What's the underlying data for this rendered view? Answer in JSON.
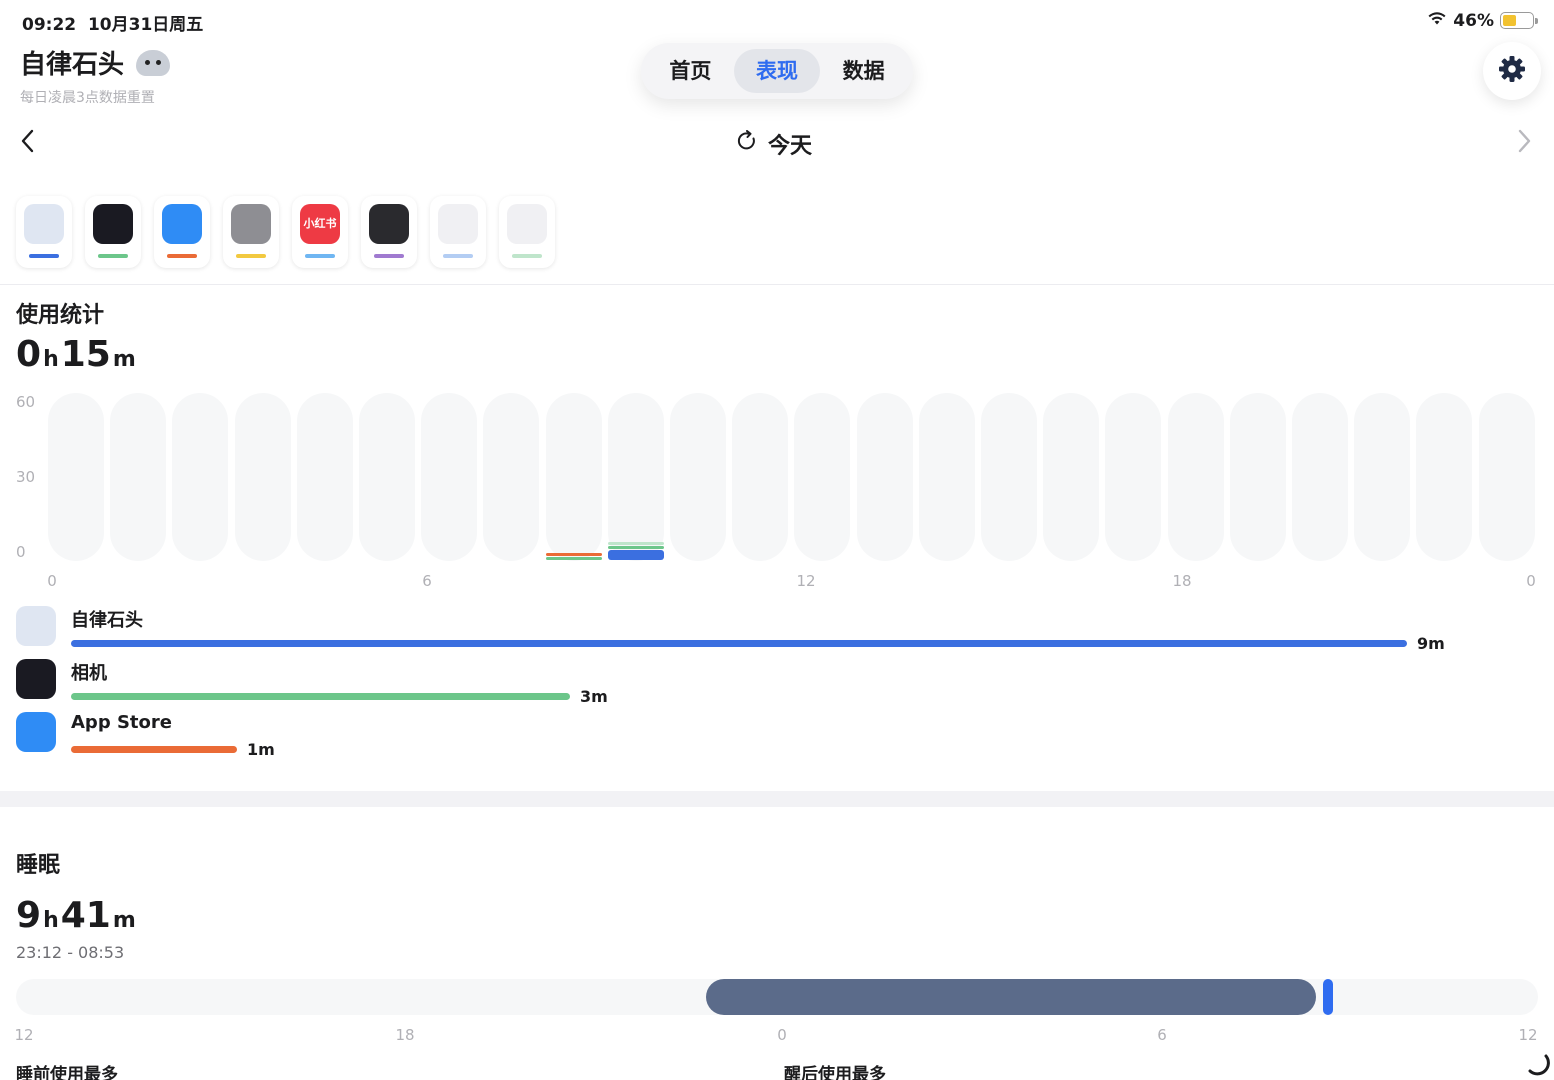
{
  "status": {
    "time": "09:22",
    "date": "10月31日周五",
    "battery": "46%",
    "battery_level": 0.46
  },
  "header": {
    "title": "自律石头",
    "subtitle": "每日凌晨3点数据重置"
  },
  "tabs": [
    {
      "label": "首页",
      "active": false
    },
    {
      "label": "表现",
      "active": true
    },
    {
      "label": "数据",
      "active": false
    }
  ],
  "date_nav": {
    "label": "今天"
  },
  "app_icons": [
    {
      "name": "mascot-icon",
      "color": "#3b6fe0",
      "icon_bg": "#dfe6f2"
    },
    {
      "name": "camera-icon",
      "color": "#6cc68a",
      "icon_bg": "#1a1a22"
    },
    {
      "name": "app-store-icon",
      "color": "#ea6b36",
      "icon_bg": "#2f8cf5"
    },
    {
      "name": "settings-app-icon",
      "color": "#f2c940",
      "icon_bg": "#8e8e93"
    },
    {
      "name": "xiaohongshu-icon",
      "color": "#6fb6f2",
      "icon_bg": "#ee3a44",
      "text": "小红书"
    },
    {
      "name": "wallet-icon",
      "color": "#a07ad0",
      "icon_bg": "#2a2a2e"
    },
    {
      "name": "placeholder-app-icon",
      "color": "#b3cdf3",
      "icon_bg": "#f0f0f3"
    },
    {
      "name": "placeholder-app-icon",
      "color": "#bfe5cb",
      "icon_bg": "#f0f0f3"
    }
  ],
  "usage": {
    "title": "使用统计",
    "hours": "0",
    "h_unit": "h",
    "minutes": "15",
    "m_unit": "m",
    "apps": [
      {
        "name": "自律石头",
        "duration": "9m",
        "minutes": 9,
        "color": "#3b6fe0",
        "icon": "mascot-icon",
        "icon_bg": "#dfe6f2"
      },
      {
        "name": "相机",
        "duration": "3m",
        "minutes": 3,
        "color": "#6cc68a",
        "icon": "camera-icon",
        "icon_bg": "#1a1a22"
      },
      {
        "name": "App Store",
        "duration": "1m",
        "minutes": 1,
        "color": "#ea6b36",
        "icon": "app-store-icon",
        "icon_bg": "#2f8cf5"
      }
    ]
  },
  "chart_data": {
    "type": "bar",
    "stacked": true,
    "categories": [
      "0",
      "1",
      "2",
      "3",
      "4",
      "5",
      "6",
      "7",
      "8",
      "9",
      "10",
      "11",
      "12",
      "13",
      "14",
      "15",
      "16",
      "17",
      "18",
      "19",
      "20",
      "21",
      "22",
      "23"
    ],
    "series": [
      {
        "name": "自律石头",
        "color": "#3b6fe0",
        "values": [
          0,
          0,
          0,
          0,
          0,
          0,
          0,
          0,
          0,
          9,
          0,
          0,
          0,
          0,
          0,
          0,
          0,
          0,
          0,
          0,
          0,
          0,
          0,
          0
        ]
      },
      {
        "name": "相机",
        "color": "#6cc68a",
        "values": [
          0,
          0,
          0,
          0,
          0,
          0,
          0,
          0,
          2,
          0.5,
          0,
          0,
          0,
          0,
          0,
          0,
          0,
          0,
          0,
          0,
          0,
          0,
          0,
          0
        ]
      },
      {
        "name": "App Store",
        "color": "#ea6b36",
        "values": [
          0,
          0,
          0,
          0,
          0,
          0,
          0,
          0,
          1,
          0,
          0,
          0,
          0,
          0,
          0,
          0,
          0,
          0,
          0,
          0,
          0,
          0,
          0,
          0
        ]
      },
      {
        "name": "",
        "color": "#bfe5cb",
        "values": [
          0,
          0,
          0,
          0,
          0,
          0,
          0,
          0,
          0,
          0.5,
          0,
          0,
          0,
          0,
          0,
          0,
          0,
          0,
          0,
          0,
          0,
          0,
          0,
          0
        ]
      }
    ],
    "y_ticks": [
      "60",
      "30",
      "0"
    ],
    "x_ticks": [
      "0",
      "6",
      "12",
      "18",
      "0"
    ],
    "ylim": [
      0,
      60
    ],
    "grid": false
  },
  "sleep": {
    "title": "睡眠",
    "hours": "9",
    "h_unit": "h",
    "minutes": "41",
    "m_unit": "m",
    "range": "23:12 - 08:53",
    "start_hour": 23.2,
    "end_hour": 32.883,
    "axis_ticks": [
      "12",
      "18",
      "0",
      "6",
      "12"
    ],
    "axis_hours": [
      12,
      18,
      24,
      30,
      36
    ]
  },
  "bottom": {
    "before_sleep": "睡前使用最多",
    "after_wake": "醒后使用最多"
  }
}
